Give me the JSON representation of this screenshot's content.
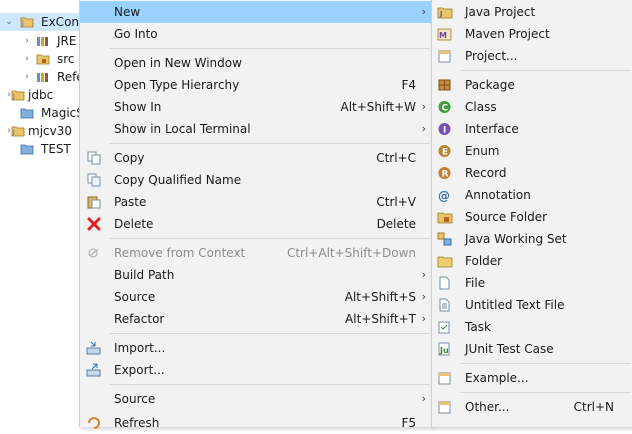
{
  "tree": {
    "items": [
      {
        "label": "ExConn"
      },
      {
        "label": "JRE"
      },
      {
        "label": "src"
      },
      {
        "label": "Refe"
      },
      {
        "label": "jdbc"
      },
      {
        "label": "MagicS"
      },
      {
        "label": "mjcv30"
      },
      {
        "label": "TEST"
      }
    ]
  },
  "context_menu": {
    "new_label": "New",
    "go_into_label": "Go Into",
    "open_new_window_label": "Open in New Window",
    "open_type_hierarchy_label": "Open Type Hierarchy",
    "open_type_hierarchy_shortcut": "F4",
    "show_in_label": "Show In",
    "show_in_shortcut": "Alt+Shift+W",
    "show_in_local_terminal_label": "Show in Local Terminal",
    "copy_label": "Copy",
    "copy_shortcut": "Ctrl+C",
    "copy_qualified_name_label": "Copy Qualified Name",
    "paste_label": "Paste",
    "paste_shortcut": "Ctrl+V",
    "delete_label": "Delete",
    "delete_shortcut": "Delete",
    "remove_from_context_label": "Remove from Context",
    "remove_from_context_shortcut": "Ctrl+Alt+Shift+Down",
    "build_path_label": "Build Path",
    "source_label": "Source",
    "source_shortcut": "Alt+Shift+S",
    "refactor_label": "Refactor",
    "refactor_shortcut": "Alt+Shift+T",
    "import_label": "Import...",
    "export_label": "Export...",
    "source2_label": "Source",
    "refresh_label": "Refresh",
    "refresh_shortcut": "F5"
  },
  "new_submenu": {
    "items": [
      {
        "label": "Java Project",
        "icon": "java-project-icon"
      },
      {
        "label": "Maven Project",
        "icon": "maven-project-icon"
      },
      {
        "label": "Project...",
        "icon": "project-icon"
      },
      {
        "label": "Package",
        "icon": "package-icon"
      },
      {
        "label": "Class",
        "icon": "class-icon"
      },
      {
        "label": "Interface",
        "icon": "interface-icon"
      },
      {
        "label": "Enum",
        "icon": "enum-icon"
      },
      {
        "label": "Record",
        "icon": "record-icon"
      },
      {
        "label": "Annotation",
        "icon": "annotation-icon"
      },
      {
        "label": "Source Folder",
        "icon": "source-folder-icon"
      },
      {
        "label": "Java Working Set",
        "icon": "working-set-icon"
      },
      {
        "label": "Folder",
        "icon": "folder-icon"
      },
      {
        "label": "File",
        "icon": "file-icon"
      },
      {
        "label": "Untitled Text File",
        "icon": "text-file-icon"
      },
      {
        "label": "Task",
        "icon": "task-icon"
      },
      {
        "label": "JUnit Test Case",
        "icon": "junit-icon"
      },
      {
        "label": "Example...",
        "icon": "example-icon"
      },
      {
        "label": "Other...",
        "icon": "other-icon",
        "shortcut": "Ctrl+N"
      }
    ]
  },
  "colors": {
    "highlight": "#99d1ff",
    "menu_bg": "#f2f2f2",
    "tree_selection": "#cde8ff"
  }
}
